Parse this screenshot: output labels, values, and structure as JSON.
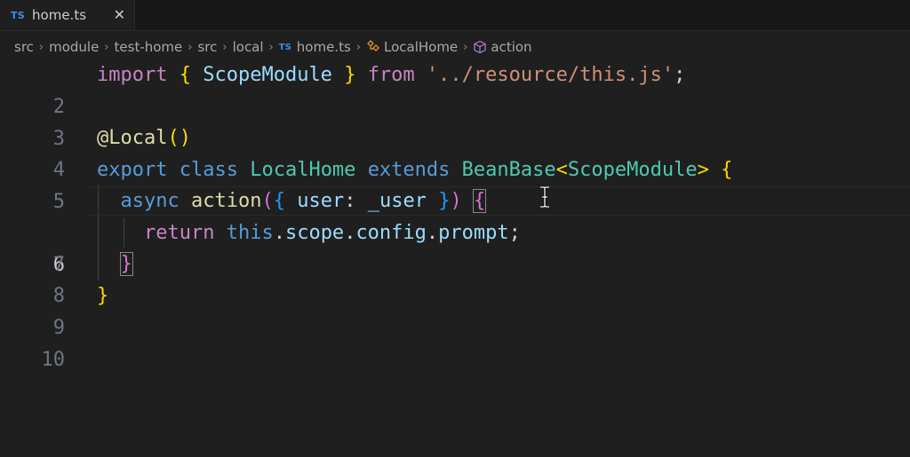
{
  "tab": {
    "lang_badge": "TS",
    "file_name": "home.ts",
    "close_glyph": "✕"
  },
  "breadcrumb": {
    "items": [
      "src",
      "module",
      "test-home",
      "src",
      "local"
    ],
    "file_badge": "TS",
    "file_name": "home.ts",
    "class_name": "LocalHome",
    "method_name": "action",
    "separator": "›"
  },
  "editor": {
    "active_line": 6,
    "line_numbers": [
      "2",
      "3",
      "4",
      "5",
      "6",
      "7",
      "8",
      "9",
      "10"
    ],
    "tokens": {
      "l2": [
        "import",
        "{",
        "ScopeModule",
        "}",
        "from",
        "'../resource/this.js'",
        ";"
      ],
      "l4": [
        "@Local",
        "(",
        ")"
      ],
      "l5": [
        "export",
        "class",
        "LocalHome",
        "extends",
        "BeanBase",
        "<",
        "ScopeModule",
        ">",
        "{"
      ],
      "l6": [
        "async",
        "action",
        "(",
        "{",
        "user",
        ":",
        "_user",
        "}",
        ")",
        "{"
      ],
      "l7": [
        "return",
        "this",
        ".",
        "scope",
        ".",
        "config",
        ".",
        "prompt",
        ";"
      ],
      "l8": [
        "}"
      ],
      "l9": [
        "}"
      ]
    }
  },
  "colors": {
    "background": "#1f1f1f",
    "keyword_control": "#c586c0",
    "keyword": "#569cd6",
    "type": "#4ec9b0",
    "variable": "#9cdcfe",
    "string": "#ce9178",
    "function": "#dcdcaa",
    "bracket_gold": "#ffd700",
    "bracket_pink": "#da70d6",
    "bracket_blue": "#179fff"
  },
  "icons": {
    "class_symbol": "class-symbol-icon",
    "method_symbol": "method-cube-icon",
    "text_cursor": "text-cursor-icon"
  }
}
